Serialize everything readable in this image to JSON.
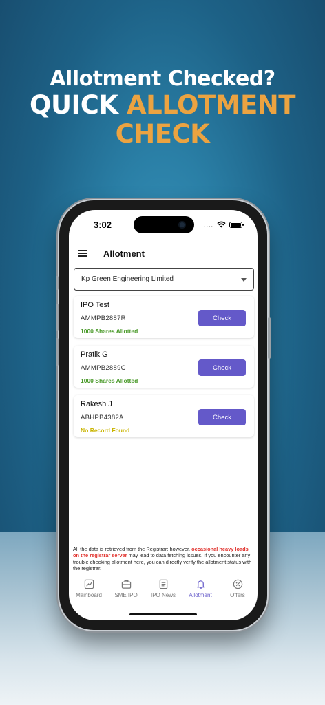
{
  "promo": {
    "line1": "Allotment Checked?",
    "line2_white": "QUICK ",
    "line2_accent": "ALLOTMENT",
    "line3": "CHECK",
    "accent_color": "#eba341"
  },
  "status_bar": {
    "time": "3:02",
    "signal_dots": "....",
    "icons": [
      "wifi-icon",
      "battery-icon"
    ]
  },
  "app_bar": {
    "menu_icon": "hamburger-icon",
    "title": "Allotment"
  },
  "ipo_select": {
    "selected": "Kp Green Engineering Limited"
  },
  "applicants": [
    {
      "name": "IPO Test",
      "pan": "AMMPB2887R",
      "status": "1000 Shares Allotted",
      "status_color": "#4a9a2a",
      "button": "Check"
    },
    {
      "name": "Pratik G",
      "pan": "AMMPB2889C",
      "status": "1000 Shares Allotted",
      "status_color": "#4a9a2a",
      "button": "Check"
    },
    {
      "name": "Rakesh J",
      "pan": "ABHPB4382A",
      "status": "No Record Found",
      "status_color": "#c9b400",
      "button": "Check"
    }
  ],
  "disclaimer": {
    "part1": "All the data is retrieved from the Registrar; however, ",
    "highlight": "occasional heavy loads on the registrar server",
    "part2": " may lead to data fetching issues. If you encounter any trouble checking allotment here, you can directly verify the allotment status with the registrar."
  },
  "nav": [
    {
      "label": "Mainboard",
      "icon": "chart-icon",
      "active": false
    },
    {
      "label": "SME IPO",
      "icon": "briefcase-icon",
      "active": false
    },
    {
      "label": "IPO News",
      "icon": "news-icon",
      "active": false
    },
    {
      "label": "Allotment",
      "icon": "bell-icon",
      "active": true
    },
    {
      "label": "Offers",
      "icon": "badge-percent-icon",
      "active": false
    }
  ],
  "colors": {
    "primary": "#6459c9"
  }
}
